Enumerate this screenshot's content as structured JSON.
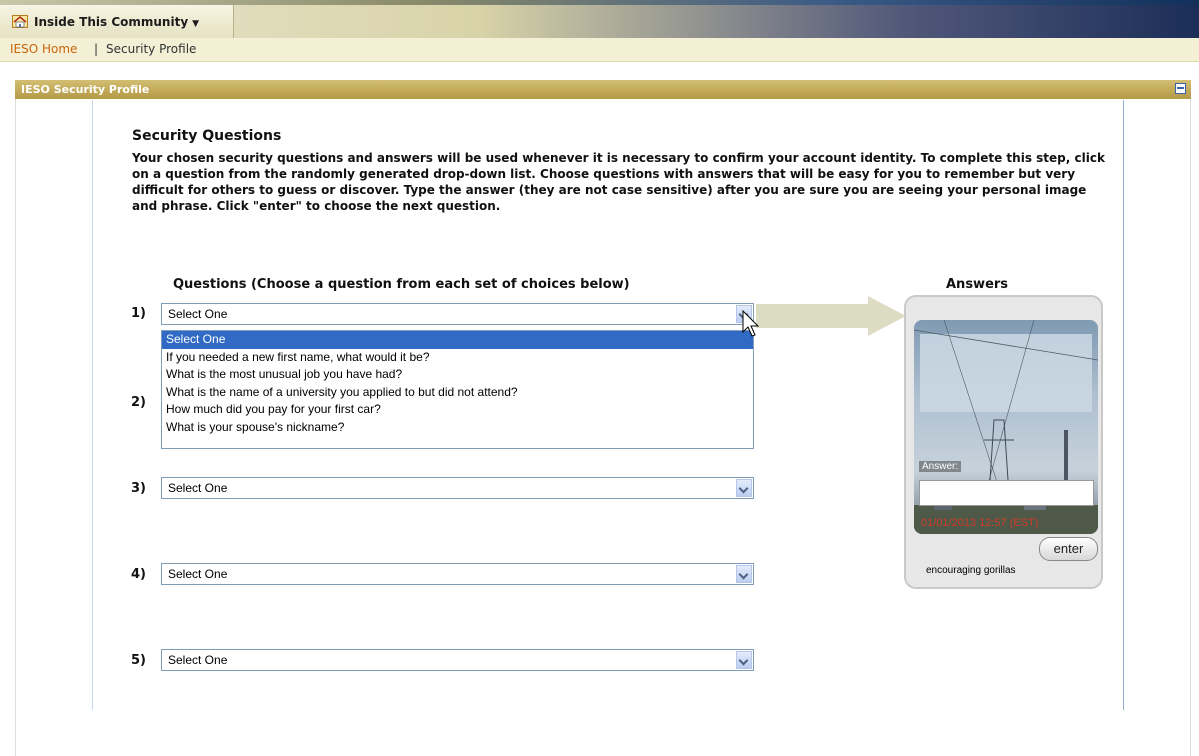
{
  "community": {
    "title": "Inside This Community",
    "home_icon": "home-icon",
    "menu_icon": "chevron-down-icon"
  },
  "breadcrumb": {
    "home": "IESO Home",
    "separator": "|",
    "current": "Security Profile"
  },
  "panel": {
    "title": "IESO Security Profile",
    "collapse_icon": "minimize-icon"
  },
  "content": {
    "heading": "Security Questions",
    "intro": "Your chosen security questions and answers will be used whenever it is necessary to confirm your account identity. To complete this step, click on a question from the randomly generated drop-down list. Choose questions with answers that will be easy for you to remember but very difficult for others to guess or discover. Type the answer (they are not case sensitive) after you are sure you are seeing your personal image and phrase. Click \"enter\" to choose the next question.",
    "questions_header": "Questions (Choose a question from each set of choices below)",
    "answers_header": "Answers"
  },
  "questions": [
    {
      "number": "1)",
      "selected": "Select One"
    },
    {
      "number": "2)",
      "selected": "Select One"
    },
    {
      "number": "3)",
      "selected": "Select One"
    },
    {
      "number": "4)",
      "selected": "Select One"
    },
    {
      "number": "5)",
      "selected": "Select One"
    }
  ],
  "dropdown_open": {
    "options": [
      "Select One",
      "If you needed a new first name, what would it be?",
      "What is the most unusual job you have had?",
      "What is the name of a university you applied to but did not attend?",
      "How much did you pay for your first car?",
      "What is your spouse's nickname?"
    ],
    "highlighted_index": 0
  },
  "answer_panel": {
    "answer_label": "Answer:",
    "timestamp": "01/01/2013 12:57 (EST)",
    "enter_label": "enter",
    "phrase": "encouraging gorillas"
  },
  "colors": {
    "link": "#c8650a",
    "header_gold": "#b49a45",
    "selection_blue": "#316ac5"
  }
}
